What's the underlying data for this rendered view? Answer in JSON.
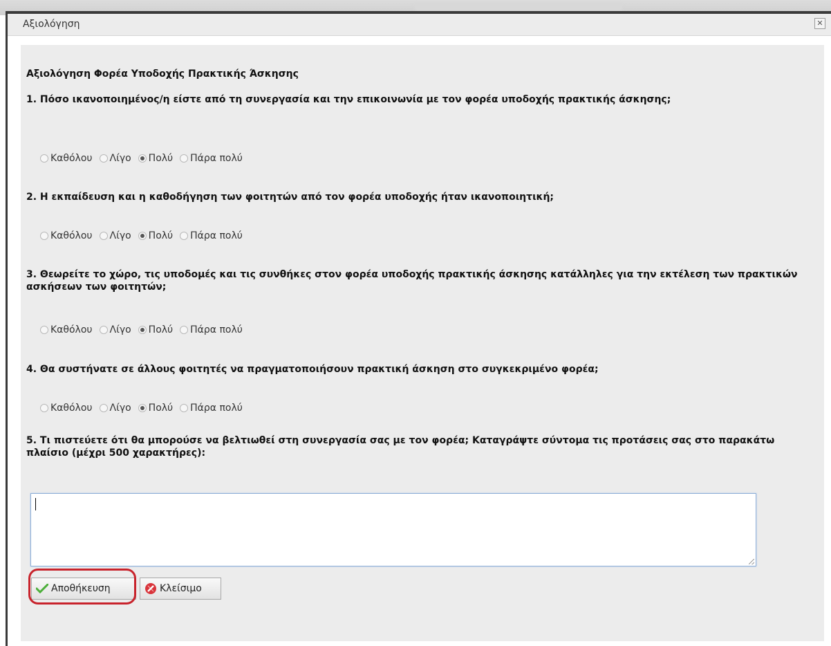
{
  "window": {
    "title": "Αξιολόγηση",
    "close_icon": "close-icon"
  },
  "form": {
    "heading": "Αξιολόγηση Φορέα Υποδοχής Πρακτικής Άσκησης",
    "questions": [
      {
        "text": "1. Πόσο ικανοποιημένος/η είστε από τη συνεργασία και την επικοινωνία με τον φορέα υποδοχής πρακτικής άσκησης;",
        "options": [
          "Καθόλου",
          "Λίγο",
          "Πολύ",
          "Πάρα πολύ"
        ],
        "selected": "Πολύ"
      },
      {
        "text": "2. Η εκπαίδευση και η καθοδήγηση των φοιτητών από τον φορέα υποδοχής ήταν ικανοποιητική;",
        "options": [
          "Καθόλου",
          "Λίγο",
          "Πολύ",
          "Πάρα πολύ"
        ],
        "selected": "Πολύ"
      },
      {
        "text": "3. Θεωρείτε το χώρο, τις υποδομές και τις συνθήκες στον φορέα υποδοχής πρακτικής άσκησης κατάλληλες για την εκτέλεση των πρακτικών ασκήσεων των φοιτητών;",
        "options": [
          "Καθόλου",
          "Λίγο",
          "Πολύ",
          "Πάρα πολύ"
        ],
        "selected": "Πολύ"
      },
      {
        "text": "4. Θα συστήνατε σε άλλους φοιτητές να πραγματοποιήσουν πρακτική άσκηση στο συγκεκριμένο φορέα;",
        "options": [
          "Καθόλου",
          "Λίγο",
          "Πολύ",
          "Πάρα πολύ"
        ],
        "selected": "Πολύ"
      }
    ],
    "q5": {
      "text": "5. Τι πιστεύετε ότι θα μπορούσε να βελτιωθεί στη συνεργασία σας με τον φορέα; Καταγράψτε σύντομα τις προτάσεις σας στο παρακάτω πλαίσιο (μέχρι 500 χαρακτήρες):",
      "value": ""
    },
    "buttons": {
      "save_label": "Αποθήκευση",
      "save_icon": "checkmark-icon",
      "close_label": "Κλείσιμο",
      "close_icon": "cancel-icon"
    }
  },
  "colors": {
    "highlight": "#c8232c",
    "panel_bg": "#ececec",
    "save_check": "#4caf3a",
    "close_icon": "#d9343b"
  }
}
